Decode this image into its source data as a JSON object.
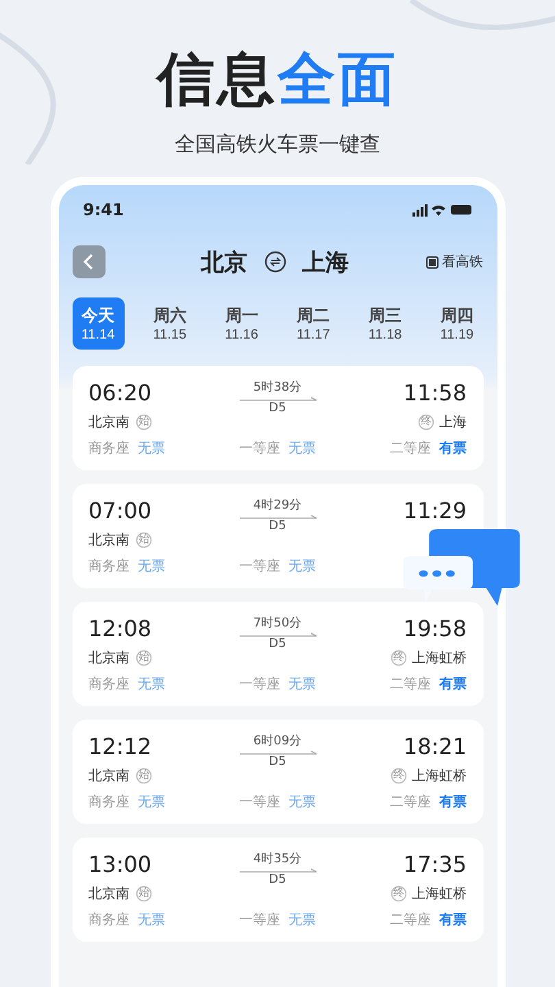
{
  "headline": {
    "plain": "信息",
    "accent": "全面"
  },
  "subtitle": "全国高铁火车票一键查",
  "status_bar": {
    "time": "9:41"
  },
  "header": {
    "from": "北京",
    "to": "上海",
    "filter": {
      "label": "看高铁",
      "checked": true
    }
  },
  "dates": [
    {
      "day": "今天",
      "date": "11.14",
      "selected": true
    },
    {
      "day": "周六",
      "date": "11.15",
      "selected": false
    },
    {
      "day": "周一",
      "date": "11.16",
      "selected": false
    },
    {
      "day": "周二",
      "date": "11.17",
      "selected": false
    },
    {
      "day": "周三",
      "date": "11.18",
      "selected": false
    },
    {
      "day": "周四",
      "date": "11.19",
      "selected": false
    }
  ],
  "trains": [
    {
      "depart": "06:20",
      "from": "北京南",
      "from_mark": "始",
      "duration": "5时38分",
      "number": "D5",
      "arrive": "11:58",
      "to_mark": "终",
      "to": "上海",
      "seats": [
        {
          "name": "商务座",
          "status": "无票",
          "available": false
        },
        {
          "name": "一等座",
          "status": "无票",
          "available": false
        },
        {
          "name": "二等座",
          "status": "有票",
          "available": true
        }
      ]
    },
    {
      "depart": "07:00",
      "from": "北京南",
      "from_mark": "始",
      "duration": "4时29分",
      "number": "D5",
      "arrive": "11:29",
      "seats": [
        {
          "name": "商务座",
          "status": "无票",
          "available": false
        },
        {
          "name": "一等座",
          "status": "无票",
          "available": false
        }
      ]
    },
    {
      "depart": "12:08",
      "from": "北京南",
      "from_mark": "始",
      "duration": "7时50分",
      "number": "D5",
      "arrive": "19:58",
      "to_mark": "终",
      "to": "上海虹桥",
      "seats": [
        {
          "name": "商务座",
          "status": "无票",
          "available": false
        },
        {
          "name": "一等座",
          "status": "无票",
          "available": false
        },
        {
          "name": "二等座",
          "status": "有票",
          "available": true
        }
      ]
    },
    {
      "depart": "12:12",
      "from": "北京南",
      "from_mark": "始",
      "duration": "6时09分",
      "number": "D5",
      "arrive": "18:21",
      "to_mark": "终",
      "to": "上海虹桥",
      "seats": [
        {
          "name": "商务座",
          "status": "无票",
          "available": false
        },
        {
          "name": "一等座",
          "status": "无票",
          "available": false
        },
        {
          "name": "二等座",
          "status": "有票",
          "available": true
        }
      ]
    },
    {
      "depart": "13:00",
      "from": "北京南",
      "from_mark": "始",
      "duration": "4时35分",
      "number": "D5",
      "arrive": "17:35",
      "to_mark": "终",
      "to": "上海虹桥",
      "seats": [
        {
          "name": "商务座",
          "status": "无票",
          "available": false
        },
        {
          "name": "一等座",
          "status": "无票",
          "available": false
        },
        {
          "name": "二等座",
          "status": "有票",
          "available": true
        }
      ]
    }
  ]
}
